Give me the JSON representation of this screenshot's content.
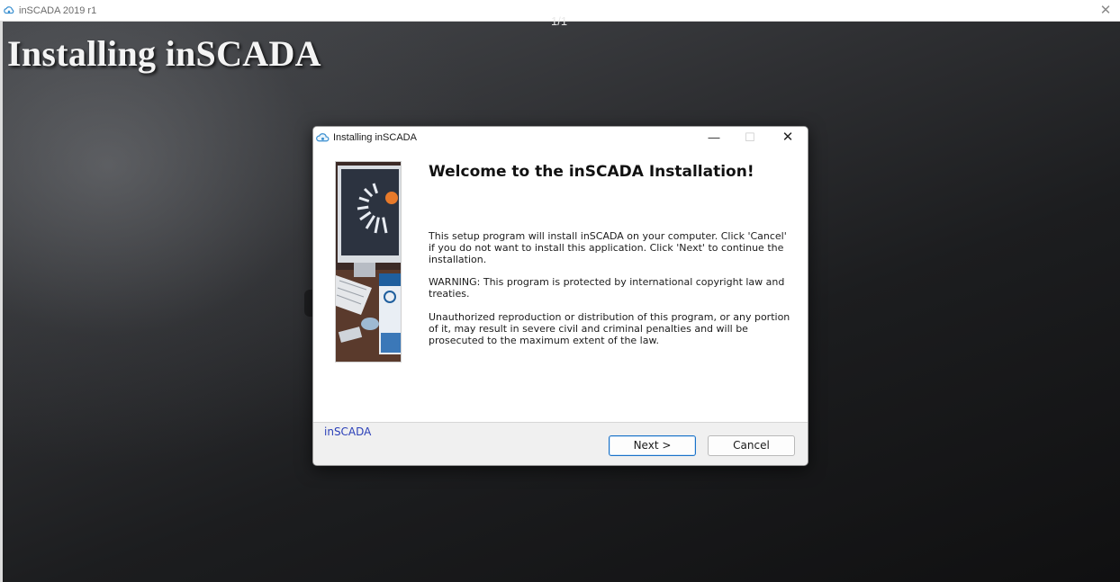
{
  "window": {
    "title": "inSCADA 2019 r1",
    "close_glyph": "✕"
  },
  "slide": {
    "counter": "1/1",
    "heading": "Installing inSCADA"
  },
  "dialog": {
    "title": "Installing inSCADA",
    "min_glyph": "—",
    "max_glyph": "☐",
    "close_glyph": "✕",
    "heading": "Welcome to the inSCADA Installation!",
    "paragraph1": "This setup program will install inSCADA on your computer. Click 'Cancel' if you do not want to install this application. Click 'Next' to continue the installation.",
    "paragraph2": "WARNING: This program is protected by international copyright law and treaties.",
    "paragraph3": "Unauthorized reproduction or distribution of this program, or any portion of it, may result in severe civil and criminal penalties and will be prosecuted to the maximum extent of the law.",
    "brand_label": "inSCADA",
    "next_label": "Next >",
    "cancel_label": "Cancel"
  },
  "colors": {
    "brand_link": "#2a3fb8",
    "accent_focus": "#1a72c8"
  },
  "icons": {
    "app": "cloud-app-icon",
    "installer_art": "scada-installer-illustration"
  }
}
